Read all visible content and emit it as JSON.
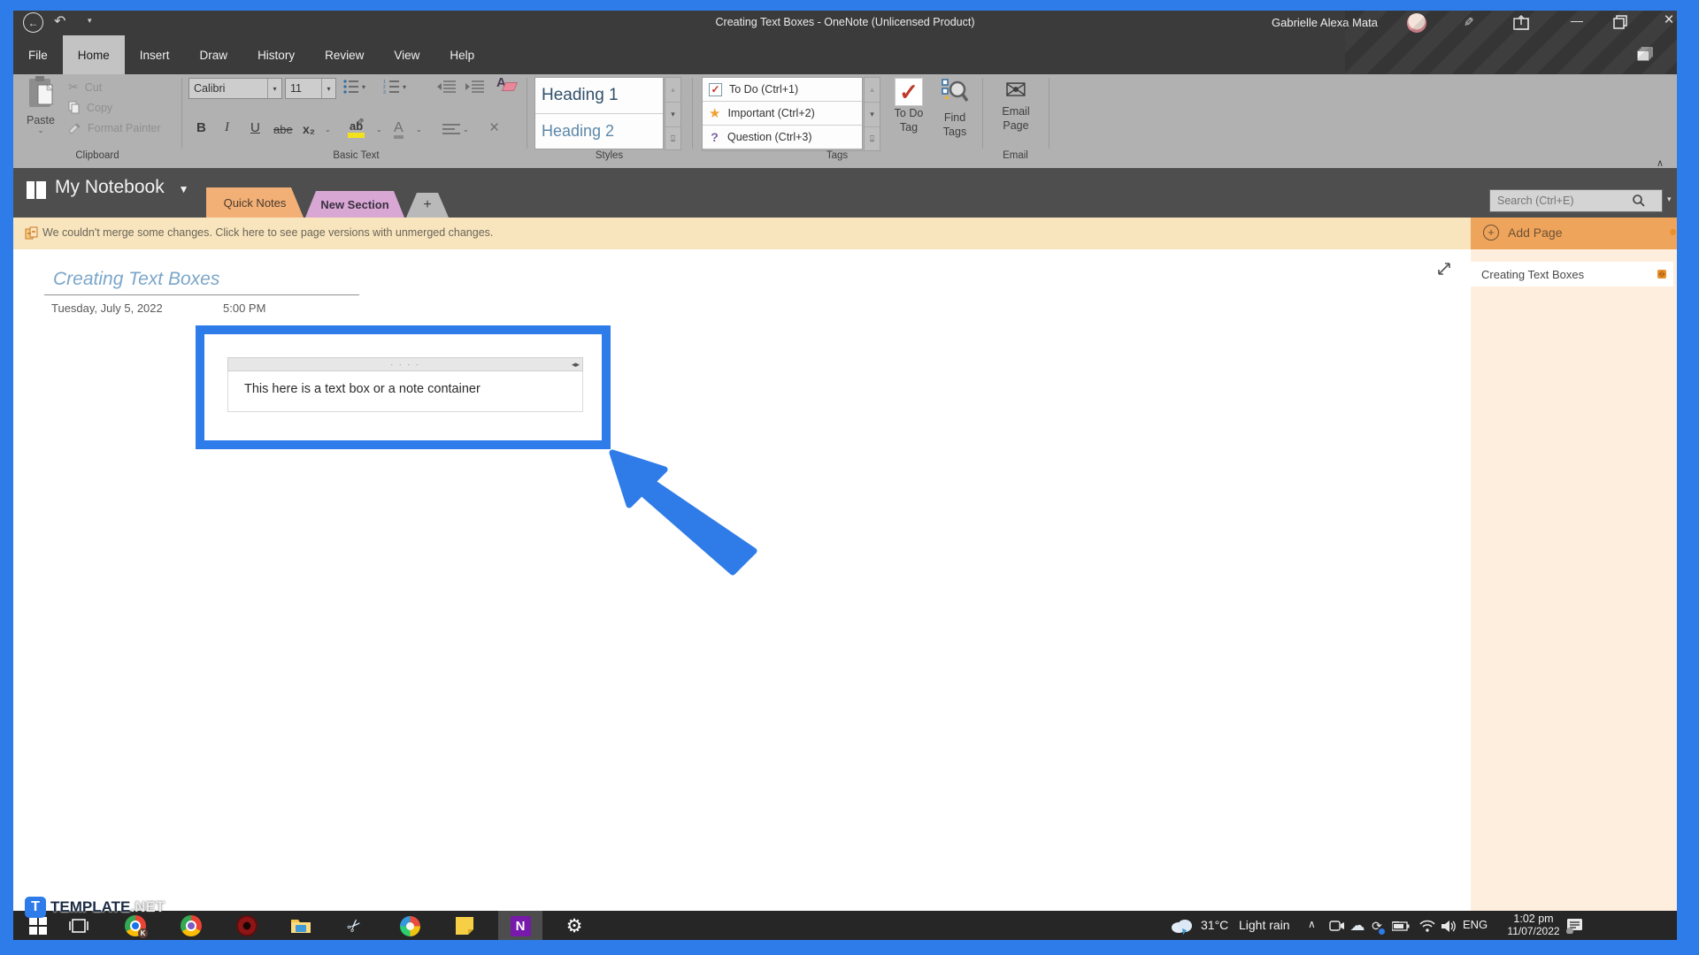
{
  "window": {
    "title": "Creating Text Boxes  -  OneNote (Unlicensed Product)",
    "user_name": "Gabrielle Alexa Mata"
  },
  "ribbon_tabs": [
    "File",
    "Home",
    "Insert",
    "Draw",
    "History",
    "Review",
    "View",
    "Help"
  ],
  "ribbon": {
    "clipboard": {
      "group_label": "Clipboard",
      "paste": "Paste",
      "cut": "Cut",
      "copy": "Copy",
      "format_painter": "Format Painter"
    },
    "basic_text": {
      "group_label": "Basic Text",
      "font_name": "Calibri",
      "font_size": "11",
      "bold": "B",
      "italic": "I",
      "underline": "U",
      "strikethrough": "abe",
      "subscript": "x₂",
      "highlight": "ab",
      "font_color": "A"
    },
    "styles": {
      "group_label": "Styles",
      "items": [
        "Heading 1",
        "Heading 2"
      ]
    },
    "tags": {
      "group_label": "Tags",
      "items": [
        "To Do (Ctrl+1)",
        "Important (Ctrl+2)",
        "Question (Ctrl+3)"
      ],
      "todo_tag_line1": "To Do",
      "todo_tag_line2": "Tag",
      "find_tags_line1": "Find",
      "find_tags_line2": "Tags"
    },
    "email": {
      "group_label": "Email",
      "email_page_line1": "Email",
      "email_page_line2": "Page"
    }
  },
  "notebook_bar": {
    "notebook_name": "My Notebook",
    "sections": [
      "Quick Notes",
      "New Section"
    ],
    "add_section": "+",
    "search_placeholder": "Search (Ctrl+E)"
  },
  "notification": {
    "message": "We couldn't merge some changes. Click here to see page versions with unmerged changes."
  },
  "sidebar": {
    "add_page": "Add Page",
    "pages": [
      "Creating Text Boxes"
    ]
  },
  "page": {
    "title": "Creating Text Boxes",
    "date": "Tuesday, July 5, 2022",
    "time": "5:00 PM",
    "note_dots": "· · · ·",
    "note_text": "This here is a text box or a note container"
  },
  "taskbar": {
    "temperature": "31°C",
    "weather": "Light rain",
    "language": "ENG",
    "time": "1:02 pm",
    "date": "11/07/2022"
  },
  "watermark": {
    "logo_letter": "T",
    "brand": "TEMPLATE",
    "tld": ".NET"
  },
  "colors": {
    "accent_blue": "#2e7cea",
    "quick_notes_tab": "#f2b077",
    "new_section_tab": "#d8a7d4",
    "warning_bg": "#f8e5be",
    "add_page_bg": "#efa45c",
    "sidebar_bg": "#fdeedd",
    "onenote_purple": "#7719aa"
  }
}
